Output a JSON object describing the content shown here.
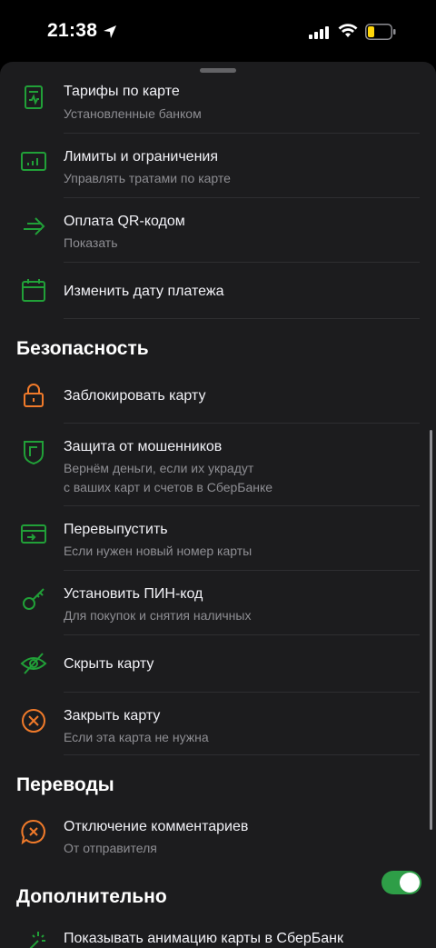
{
  "status": {
    "time": "21:38"
  },
  "card_settings": {
    "items": [
      {
        "title": "Тарифы по карте",
        "subtitle": "Установленные банком",
        "icon": "tariff-doc-icon"
      },
      {
        "title": "Лимиты и ограничения",
        "subtitle": "Управлять тратами по карте",
        "icon": "limits-chart-icon"
      },
      {
        "title": "Оплата QR-кодом",
        "subtitle": "Показать",
        "icon": "qr-pay-arrow-icon"
      },
      {
        "title": "Изменить дату платежа",
        "icon": "calendar-icon"
      }
    ]
  },
  "security": {
    "heading": "Безопасность",
    "items": [
      {
        "title": "Заблокировать карту",
        "icon": "lock-icon"
      },
      {
        "title": "Защита от мошенников",
        "subtitle_line1": "Вернём деньги, если их украдут",
        "subtitle_line2": "с ваших карт и счетов в СберБанке",
        "icon": "shield-icon"
      },
      {
        "title": "Перевыпустить",
        "subtitle": "Если нужен новый номер карты",
        "icon": "reissue-card-icon"
      },
      {
        "title": "Установить ПИН-код",
        "subtitle": "Для покупок и снятия наличных",
        "icon": "key-icon"
      },
      {
        "title": "Скрыть карту",
        "icon": "eye-hidden-icon"
      },
      {
        "title": "Закрыть карту",
        "subtitle": "Если эта карта не нужна",
        "icon": "close-circle-icon"
      }
    ]
  },
  "transfers": {
    "heading": "Переводы",
    "items": [
      {
        "title": "Отключение комментариев",
        "subtitle": "От отправителя",
        "icon": "comment-off-icon"
      }
    ]
  },
  "additional": {
    "heading": "Дополнительно",
    "items": [
      {
        "title": "Показывать анимацию карты в СберБанк",
        "icon": "sparkle-wand-icon",
        "toggle_on": true
      }
    ]
  },
  "colors": {
    "accent_green": "#21a038",
    "accent_orange": "#f07a2a",
    "toggle_on": "#2e9e47"
  }
}
